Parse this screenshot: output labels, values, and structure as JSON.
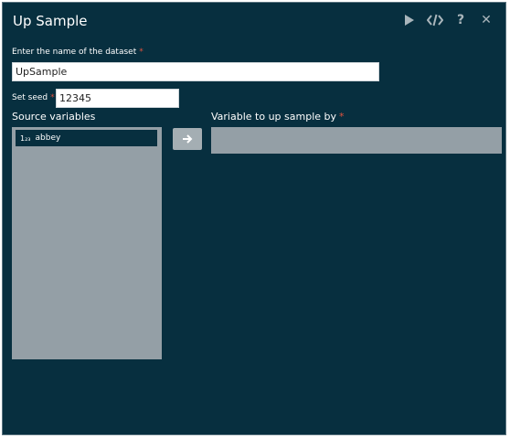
{
  "dialog": {
    "title": "Up Sample",
    "toolbar": {
      "run_icon": "play-icon",
      "code_icon": "code-icon",
      "help_icon": "help-icon",
      "close_icon": "close-icon",
      "help_label": "?",
      "close_label": "✕"
    }
  },
  "dataset": {
    "label": "Enter the name of the dataset",
    "required_mark": "*",
    "value": "UpSample"
  },
  "seed": {
    "label": "Set seed",
    "required_mark": "*",
    "value": "12345"
  },
  "source": {
    "label": "Source variables",
    "items": [
      {
        "type_icon": "1₂₃",
        "name": "abbey"
      }
    ]
  },
  "target": {
    "label": "Variable to up sample by",
    "required_mark": "*",
    "move_icon": "arrow-right-icon"
  },
  "colors": {
    "background": "#072f3f",
    "listbox": "#949fa6",
    "required": "#e0533f"
  }
}
